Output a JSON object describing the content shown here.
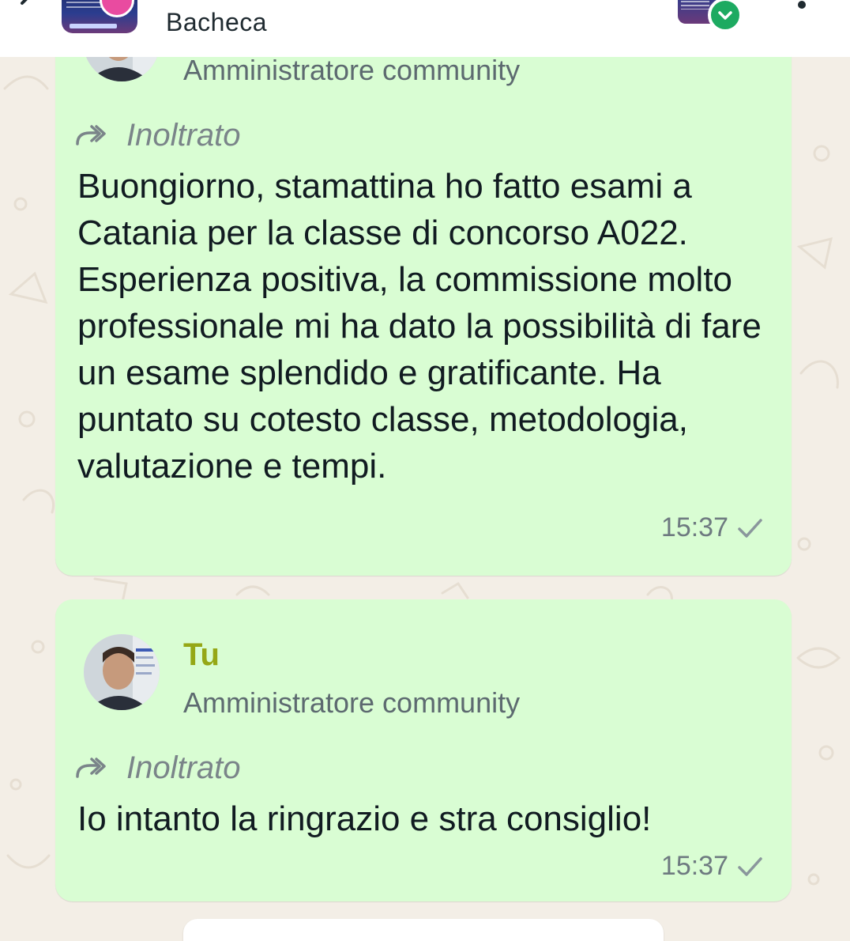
{
  "header": {
    "title": "Bacheca",
    "back_icon": "arrow-left-icon",
    "menu_icon": "more-vertical-icon",
    "check_icon": "chevron-down-icon"
  },
  "colors": {
    "bubble": "#d9fdd3",
    "sender_name": "#95a716",
    "background": "#f3eee6",
    "badge": "#1daa61"
  },
  "messages": [
    {
      "sender_role": "Amministratore community",
      "forward_label": "Inoltrato",
      "text": "Buongiorno, stamattina ho fatto esami a Catania per la classe di concorso A022. Esperienza positiva, la commissione molto professionale mi ha dato la possibilità di fare un esame splendido e gratificante. Ha puntato su cotesto classe, metodologia, valutazione e tempi.",
      "time": "15:37",
      "status_icon": "single-check-icon"
    },
    {
      "sender_name": "Tu",
      "sender_role": "Amministratore community",
      "forward_label": "Inoltrato",
      "text": "Io intanto la ringrazio e stra consiglio!",
      "time": "15:37",
      "status_icon": "single-check-icon"
    }
  ]
}
